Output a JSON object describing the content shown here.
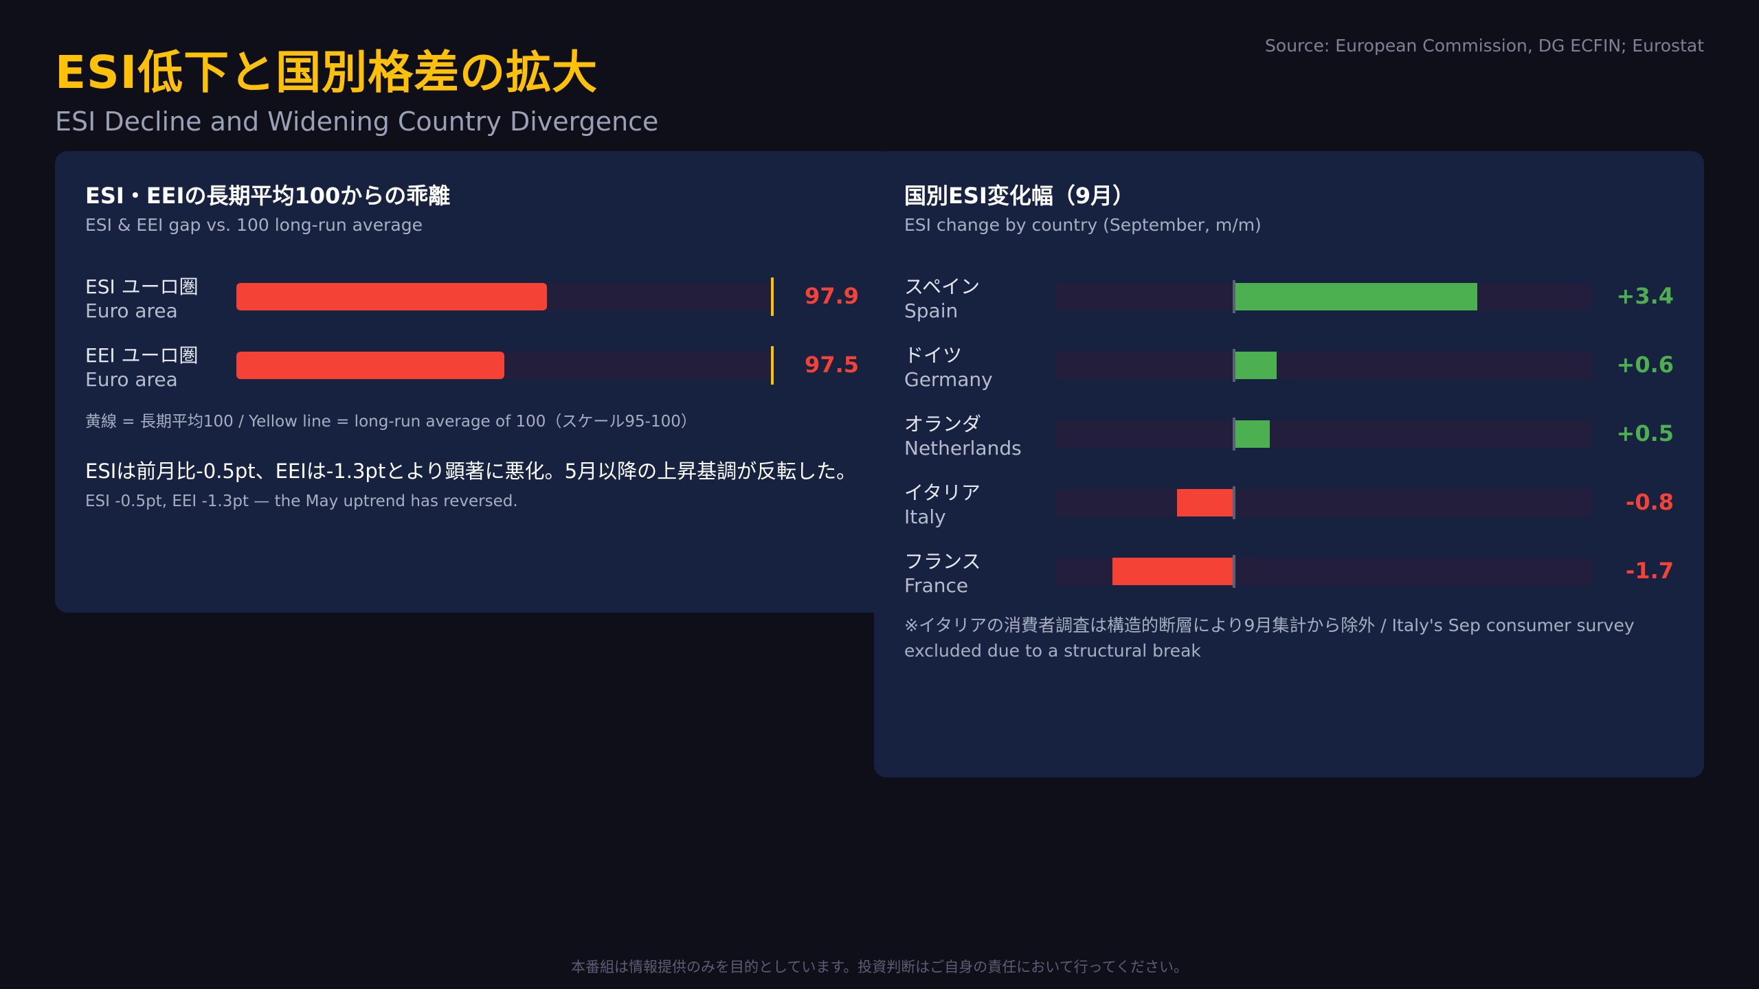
{
  "header": {
    "title": "ESI低下と国別格差の拡大",
    "subtitle": "ESI Decline and Widening Country Divergence",
    "source": "Source: European Commission, DG ECFIN; Eurostat"
  },
  "left_panel": {
    "title": "ESI・EEIの長期平均100からの乖離",
    "subtitle": "ESI & EEI gap vs. 100 long-run average",
    "note": "黄線 = 長期平均100 / Yellow line = long-run average of 100（スケール95-100）",
    "comment_jp": "ESIは前月比-0.5pt、EEIは-1.3ptとより顕著に悪化。5月以降の上昇基調が反転した。",
    "comment_en": "ESI -0.5pt, EEI -1.3pt — the May uptrend has reversed."
  },
  "right_panel": {
    "title": "国別ESI変化幅（9月）",
    "subtitle": "ESI change by country (September, m/m)",
    "note": "※イタリアの消費者調査は構造的断層により9月集計から除外 / Italy's Sep consumer survey excluded due to a structural break"
  },
  "footer": {
    "disclaimer": "本番組は情報提供のみを目的としています。投資判断はご自身の責任において行ってください。"
  },
  "colors": {
    "negative": "#f44336",
    "positive": "#4caf50",
    "reference": "#ffc107",
    "accent": "#ffc107"
  },
  "chart_data": [
    {
      "type": "bar",
      "orientation": "horizontal",
      "title": "ESI・EEIの長期平均100からの乖離",
      "xlim": [
        95,
        100
      ],
      "reference_value": 100,
      "categories": [
        {
          "jp": "ESI ユーロ圏",
          "en": "Euro area"
        },
        {
          "jp": "EEI ユーロ圏",
          "en": "Euro area"
        }
      ],
      "values": [
        97.9,
        97.5
      ],
      "labels": [
        "97.9",
        "97.5"
      ]
    },
    {
      "type": "bar",
      "orientation": "horizontal",
      "title": "国別ESI変化幅（9月）",
      "xlim": [
        -2.5,
        5.0
      ],
      "categories": [
        {
          "jp": "スペイン",
          "en": "Spain"
        },
        {
          "jp": "ドイツ",
          "en": "Germany"
        },
        {
          "jp": "オランダ",
          "en": "Netherlands"
        },
        {
          "jp": "イタリア",
          "en": "Italy"
        },
        {
          "jp": "フランス",
          "en": "France"
        }
      ],
      "values": [
        3.4,
        0.6,
        0.5,
        -0.8,
        -1.7
      ],
      "labels": [
        "+3.4",
        "+0.6",
        "+0.5",
        "-0.8",
        "-1.7"
      ]
    }
  ]
}
